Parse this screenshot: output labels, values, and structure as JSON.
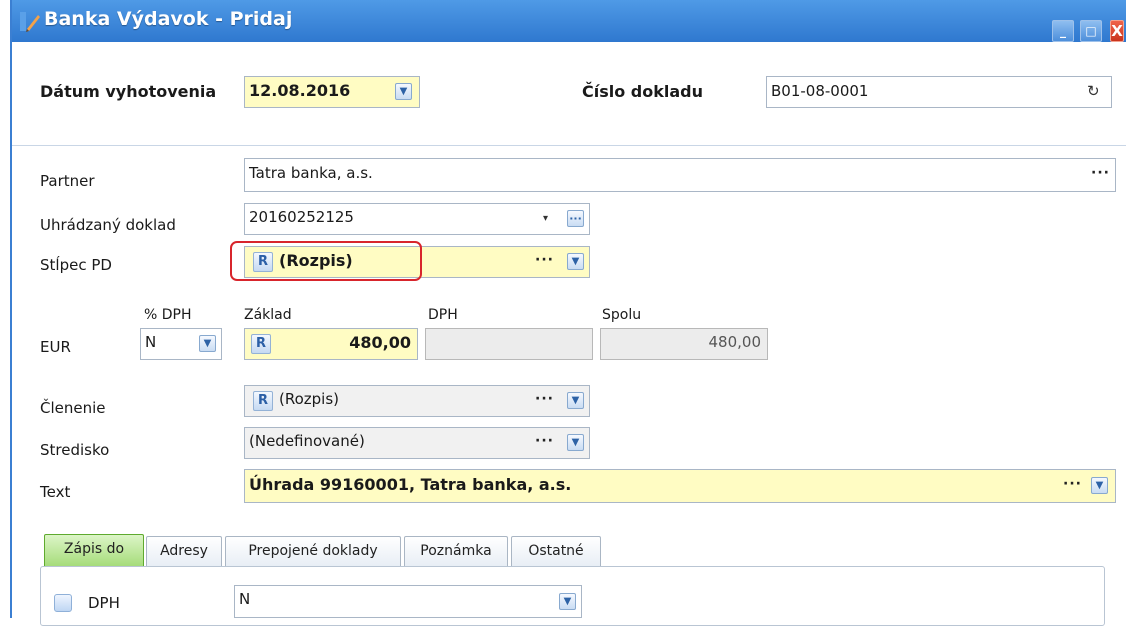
{
  "window": {
    "title": "Banka Výdavok - Pridaj",
    "controls": {
      "minimize": "_",
      "maximize": "□",
      "close": "X"
    }
  },
  "header": {
    "date_label": "Dátum vyhotovenia",
    "date_value": "12.08.2016",
    "doc_number_label": "Číslo dokladu",
    "doc_number_value": "B01-08-0001"
  },
  "form": {
    "partner": {
      "label": "Partner",
      "value": "Tatra banka, a.s."
    },
    "paid_document": {
      "label": "Uhrádzaný doklad",
      "value": "20160252125"
    },
    "pd_column": {
      "label": "Stĺpec PD",
      "badge": "R",
      "value": "(Rozpis)"
    },
    "amounts": {
      "currency_label": "EUR",
      "vat_pct_label": "% DPH",
      "vat_pct_value": "N",
      "base_label": "Základ",
      "base_badge": "R",
      "base_value": "480,00",
      "vat_label": "DPH",
      "vat_value": "",
      "total_label": "Spolu",
      "total_value": "480,00"
    },
    "breakdown": {
      "label": "Členenie",
      "badge": "R",
      "value": "(Rozpis)"
    },
    "center": {
      "label": "Stredisko",
      "value": "(Nedefinované)"
    },
    "text": {
      "label": "Text",
      "value": "Úhrada 99160001, Tatra banka, a.s."
    }
  },
  "tabs": [
    {
      "label": "Zápis do",
      "active": true
    },
    {
      "label": "Adresy",
      "active": false
    },
    {
      "label": "Prepojené doklady",
      "active": false
    },
    {
      "label": "Poznámka",
      "active": false
    },
    {
      "label": "Ostatné",
      "active": false
    }
  ],
  "tab_content": {
    "vat_checkbox_label": "DPH",
    "vat_select_value": "N"
  },
  "glyphs": {
    "dots": "···",
    "dropdown": "▼",
    "caret": "▾",
    "refresh": "↻",
    "pencil": "✎"
  },
  "colors": {
    "titlebar": "#2f78cf",
    "required_field": "#fffcc3",
    "active_tab": "#a6dc7a",
    "highlight": "#d8252c"
  }
}
